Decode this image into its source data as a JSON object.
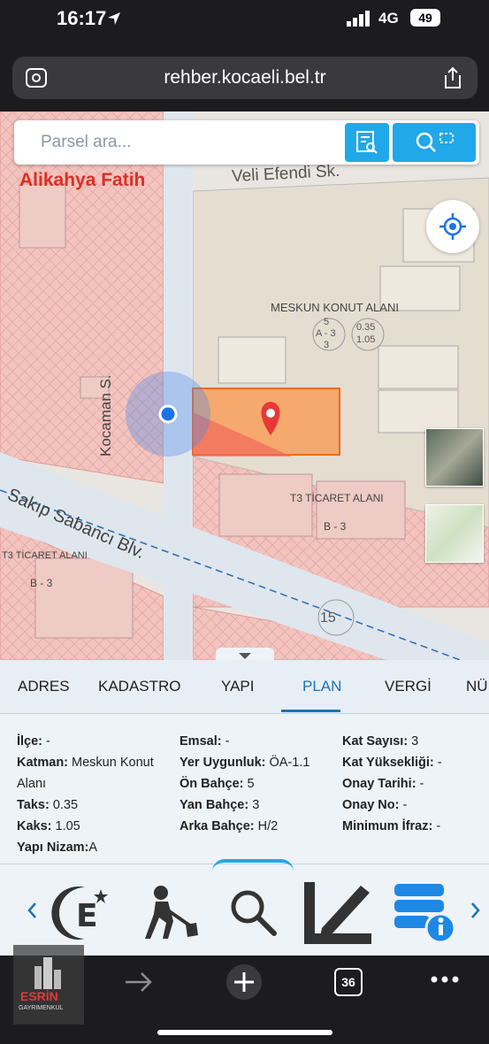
{
  "status": {
    "time": "16:17",
    "network": "4G",
    "battery": "49"
  },
  "browser": {
    "url": "rehber.kocaeli.bel.tr",
    "tab_count": "36"
  },
  "search": {
    "placeholder": "Parsel ara..."
  },
  "map": {
    "labels": {
      "owner": "Alikahya Fatih",
      "street_top": "Veli Efendi Sk.",
      "street_left": "Kocaman S.",
      "boulevard": "Sakıp Sabancı Blv.",
      "zone_main": "MESKUN KONUT ALANI",
      "zone_commercial": "T3 TİCARET ALANI",
      "zone_commercial_left": "T3 TİCARET ALANI",
      "badge_b3": "B - 3",
      "badge_b3_left": "B - 3",
      "speed": "15",
      "plan_code_top": "5",
      "plan_code_mid": "A - 3",
      "plan_code_bot": "3",
      "ratio_top": "0.35",
      "ratio_bot": "1.05"
    }
  },
  "tabs": [
    "ADRES",
    "KADASTRO",
    "YAPI",
    "PLAN",
    "VERGİ",
    "NÜ"
  ],
  "active_tab": "PLAN",
  "plan": {
    "col1": [
      {
        "k": "İlçe:",
        "v": " -"
      },
      {
        "k": "Katman:",
        "v": " Meskun Konut"
      },
      {
        "k": "",
        "v": "Alanı"
      },
      {
        "k": "Taks:",
        "v": " 0.35"
      },
      {
        "k": "Kaks:",
        "v": " 1.05"
      },
      {
        "k": "Yapı Nizam:",
        "v": "A"
      }
    ],
    "col2": [
      {
        "k": "Emsal:",
        "v": " -"
      },
      {
        "k": "Yer Uygunluk:",
        "v": " ÖA-1.1"
      },
      {
        "k": "Ön Bahçe:",
        "v": " 5"
      },
      {
        "k": "Yan Bahçe:",
        "v": " 3"
      },
      {
        "k": "Arka Bahçe:",
        "v": " H/2"
      }
    ],
    "col3": [
      {
        "k": "Kat Sayısı:",
        "v": " 3"
      },
      {
        "k": "Kat Yüksekliği:",
        "v": " -"
      },
      {
        "k": "Onay Tarihi:",
        "v": " -"
      },
      {
        "k": "Onay No:",
        "v": " -"
      },
      {
        "k": "Minimum İfraz:",
        "v": " -"
      }
    ]
  },
  "watermark": {
    "brand": "ESRİN",
    "sub": "GAYRIMENKUL"
  },
  "colors": {
    "accent": "#1a73b8",
    "parcel": "#f7a05a",
    "zone_pink": "#f5c1bc",
    "search_btn": "#20a8e8"
  }
}
